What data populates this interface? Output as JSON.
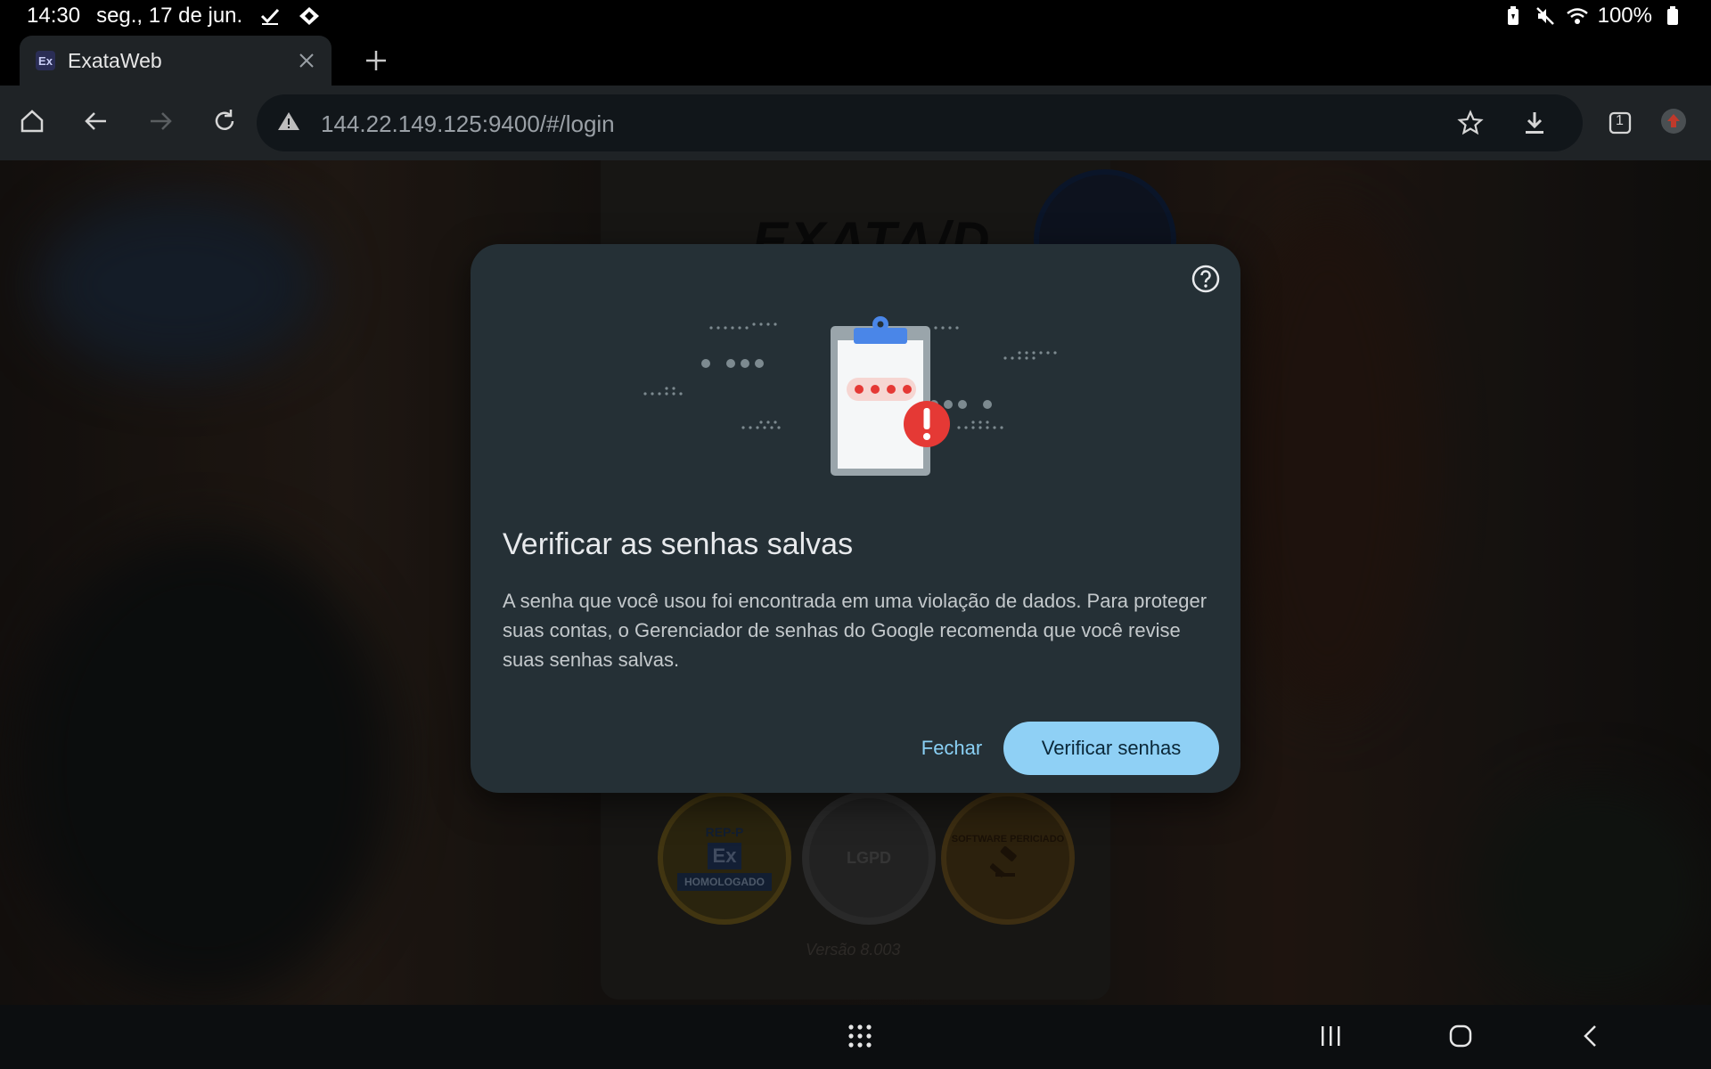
{
  "status_bar": {
    "time": "14:30",
    "date": "seg., 17 de jun.",
    "battery": "100%",
    "icons": [
      "check-icon",
      "diamond-arrows-icon",
      "battery-saver-icon",
      "mute-icon",
      "wifi-icon",
      "battery-icon"
    ]
  },
  "browser": {
    "tab": {
      "favicon_text": "Ex",
      "title": "ExataWeb"
    },
    "url": "144.22.149.125:9400/#/login",
    "tab_count": "1"
  },
  "background_page": {
    "logo_text": "EXATA/D",
    "badges": {
      "rep": {
        "top": "REP-P",
        "mark": "Ex",
        "ribbon": "HOMOLOGADO"
      },
      "lgpd": {
        "mark": "LGPD"
      },
      "soft": {
        "arc": "SOFTWARE PERICIADO"
      }
    },
    "version": "Versão 8.003"
  },
  "dialog": {
    "title": "Verificar as senhas salvas",
    "body": "A senha que você usou foi encontrada em uma violação de dados. Para proteger suas contas, o Gerenciador de senhas do Google recomenda que você revise suas senhas salvas.",
    "close_label": "Fechar",
    "check_label": "Verificar senhas"
  },
  "colors": {
    "dialog_bg": "#253036",
    "primary_button": "#8fd0f5",
    "link_text": "#8ad0f5",
    "alert_red": "#e53935",
    "clipboard_blue": "#4a86e8"
  }
}
